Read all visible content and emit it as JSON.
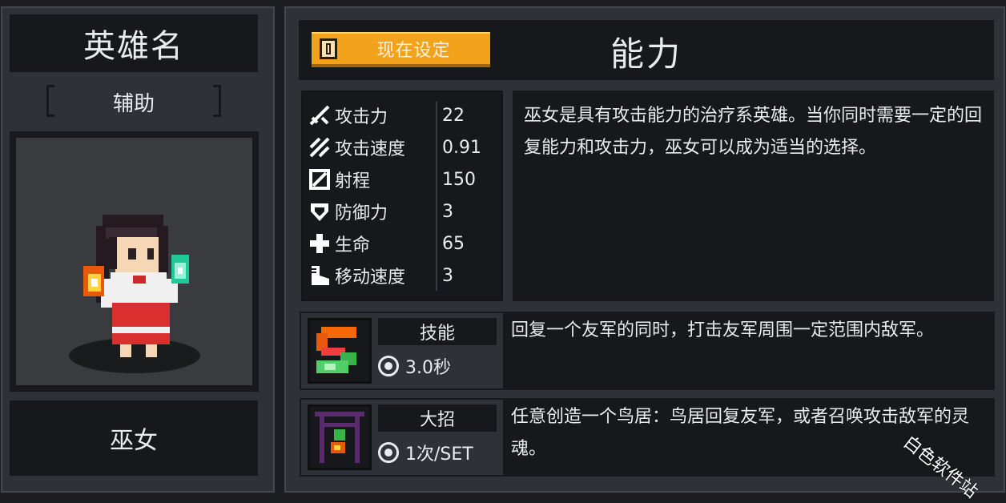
{
  "hero_panel": {
    "title": "英雄名",
    "role": "辅助",
    "class_name": "巫女"
  },
  "abilities_panel": {
    "set_button_label": "现在设定",
    "title": "能力",
    "stats": [
      {
        "icon": "sword-icon",
        "name": "攻击力",
        "value": "22"
      },
      {
        "icon": "attack-speed-icon",
        "name": "攻击速度",
        "value": "0.91"
      },
      {
        "icon": "range-icon",
        "name": "射程",
        "value": "150"
      },
      {
        "icon": "shield-icon",
        "name": "防御力",
        "value": "3"
      },
      {
        "icon": "health-cross-icon",
        "name": "生命",
        "value": "65"
      },
      {
        "icon": "boot-icon",
        "name": "移动速度",
        "value": "3"
      }
    ],
    "description": "巫女是具有攻击能力的治疗系英雄。当你同时需要一定的回复能力和攻击力，巫女可以成为适当的选择。",
    "skill": {
      "label": "技能",
      "cooldown": "3.0秒",
      "description": "回复一个友军的同时，打击友军周围一定范围内敌军。"
    },
    "ultimate": {
      "label": "大招",
      "cooldown": "1次/SET",
      "description": "任意创造一个鸟居：鸟居回复友军，或者召唤攻击敌军的灵魂。"
    }
  },
  "watermark": "白色软件站",
  "colors": {
    "accent": "#f3a21c",
    "panel": "#2e3136",
    "dark": "#16181b"
  }
}
